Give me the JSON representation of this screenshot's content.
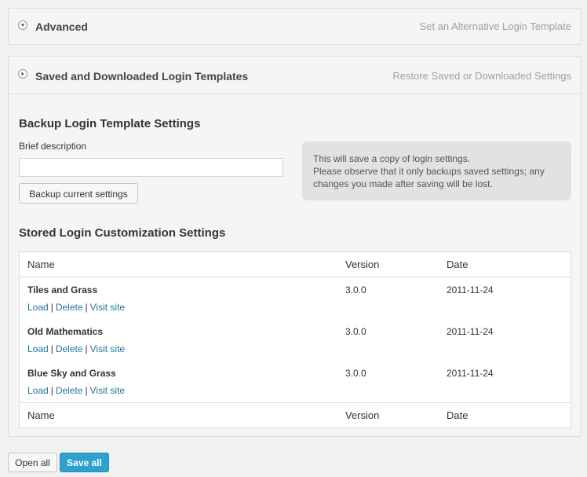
{
  "panels": {
    "advanced": {
      "title": "Advanced",
      "subtitle": "Set an Alternative Login Template"
    },
    "saved": {
      "title": "Saved and Downloaded Login Templates",
      "subtitle": "Restore Saved or Downloaded Settings"
    }
  },
  "backup": {
    "heading": "Backup Login Template Settings",
    "description_label": "Brief description",
    "description_value": "",
    "button_label": "Backup current settings",
    "info_line1": "This will save a copy of login settings.",
    "info_line2": "Please observe that it only backups saved settings; any",
    "info_line3": "changes you made after saving will be lost."
  },
  "stored": {
    "heading": "Stored Login Customization Settings",
    "columns": [
      "Name",
      "Version",
      "Date"
    ],
    "rows": [
      {
        "name": "Tiles and Grass",
        "version": "3.0.0",
        "date": "2011-11-24"
      },
      {
        "name": "Old Mathematics",
        "version": "3.0.0",
        "date": "2011-11-24"
      },
      {
        "name": "Blue Sky and Grass",
        "version": "3.0.0",
        "date": "2011-11-24"
      }
    ],
    "actions": {
      "load": "Load",
      "delete": "Delete",
      "visit": "Visit site",
      "separator": "|"
    }
  },
  "footer": {
    "open_all_label": "Open all",
    "save_all_label": "Save all"
  },
  "colors": {
    "accent": "#2ea2cc",
    "link": "#21759b"
  },
  "icons": {
    "advanced_toggle": "chevron-down-icon",
    "saved_toggle": "chevron-right-icon"
  }
}
